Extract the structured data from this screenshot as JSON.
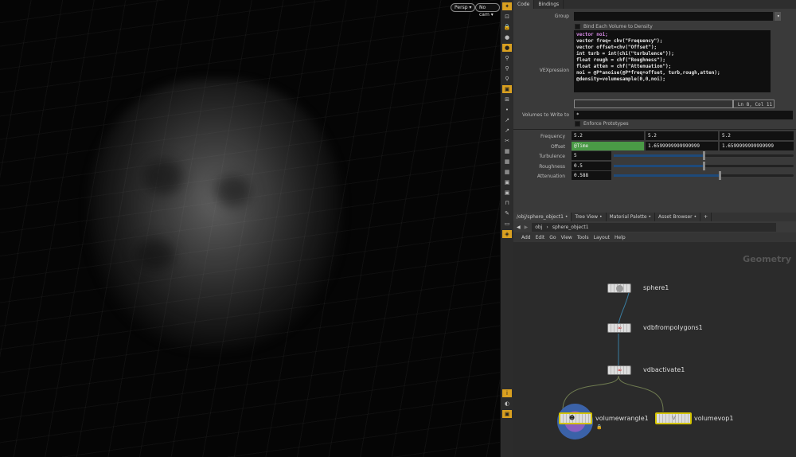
{
  "viewport": {
    "camera_menu": "Persp",
    "cam_menu": "No cam"
  },
  "params": {
    "tabs": [
      "Code",
      "Bindings"
    ],
    "group_label": "Group",
    "group_value": "",
    "bind_each_label": "Bind Each Volume to Density",
    "vexpression_label": "VEXpression",
    "code_lines": [
      "vector noi;",
      "vector freq= chv(\"Frequency\");",
      "vector offset=chv(\"Offset\");",
      "int turb = int(chi(\"turbulence\"));",
      "float rough = chf(\"Roughness\");",
      "float atten = chf(\"Attenuation\");",
      "",
      "noi = @P*anoise(@P*freq+offset, turb,rough,atten);",
      "@density=volumesample(0,0,noi);"
    ],
    "cursor_status": "Ln 8, Col 11",
    "volumes_label": "Volumes to Write to",
    "volumes_value": "*",
    "enforce_label": "Enforce Prototypes",
    "frequency_label": "Frequency",
    "frequency": [
      "5.2",
      "5.2",
      "5.2"
    ],
    "offset_label": "Offset",
    "offset": [
      "@Time",
      "1.6599999999999999",
      "1.6599999999999999"
    ],
    "turbulence_label": "Turbulence",
    "turbulence": "5",
    "turbulence_frac": 0.5,
    "roughness_label": "Roughness",
    "roughness": "0.5",
    "roughness_frac": 0.5,
    "attenuation_label": "Attenuation",
    "attenuation": "0.588",
    "attenuation_frac": 0.59
  },
  "network": {
    "tabs": [
      "/obj/sphere_object1",
      "Tree View",
      "Material Palette",
      "Asset Browser",
      "+"
    ],
    "path": [
      "obj",
      "sphere_object1"
    ],
    "menu": [
      "Add",
      "Edit",
      "Go",
      "View",
      "Tools",
      "Layout",
      "Help"
    ],
    "context_label": "Geometry",
    "nodes": [
      "sphere1",
      "vdbfrompolygons1",
      "vdbactivate1",
      "volumewrangle1",
      "volumevop1"
    ]
  }
}
